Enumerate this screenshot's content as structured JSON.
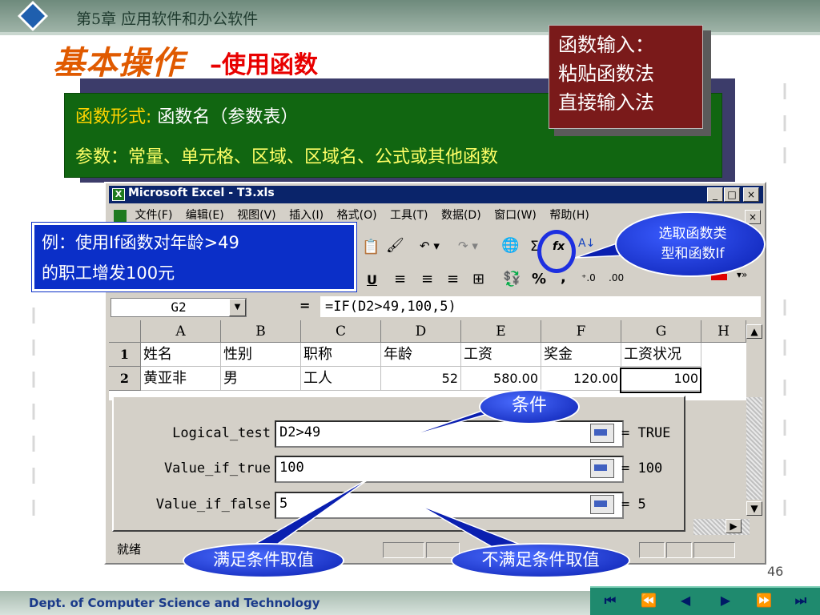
{
  "slide": {
    "chapter": "第5章 应用软件和办公软件",
    "title_main": "基本操作",
    "title_sub": "–使用函数",
    "page_number": "46",
    "footer": "Dept. of Computer Science and Technology"
  },
  "green_box": {
    "line1_label": "函数形式:",
    "line1_text": "函数名（参数表）",
    "line2": "参数：常量、单元格、区域、区域名、公式或其他函数"
  },
  "red_box": {
    "line1": "函数输入：",
    "line2": "粘贴函数法",
    "line3": "直接输入法"
  },
  "callouts": {
    "example_line1": "例：使用If函数对年龄>49",
    "example_line2": "的职工增发100元",
    "select_line1": "选取函数类",
    "select_line2": "型和函数If",
    "condition": "条件",
    "true_value": "满足条件取值",
    "false_value": "不满足条件取值"
  },
  "excel": {
    "window_title": "Microsoft Excel - T3.xls",
    "menus": [
      "文件(F)",
      "编辑(E)",
      "视图(V)",
      "插入(I)",
      "格式(O)",
      "工具(T)",
      "数据(D)",
      "窗口(W)",
      "帮助(H)"
    ],
    "name_box": "G2",
    "formula": "=IF(D2>49,100,5)",
    "columns": [
      "A",
      "B",
      "C",
      "D",
      "E",
      "F",
      "G",
      "H"
    ],
    "rows": [
      {
        "num": "1",
        "cells": [
          "姓名",
          "性别",
          "职称",
          "年龄",
          "工资",
          "奖金",
          "工资状况"
        ]
      },
      {
        "num": "2",
        "cells": [
          "黄亚非",
          "男",
          "工人",
          "52",
          "580.00",
          "120.00",
          "100"
        ]
      }
    ],
    "status": "就绪"
  },
  "dialog": {
    "args": [
      {
        "label": "Logical_test",
        "value": "D2>49",
        "result": "= TRUE"
      },
      {
        "label": "Value_if_true",
        "value": "100",
        "result": "= 100"
      },
      {
        "label": "Value_if_false",
        "value": "5",
        "result": "= 5"
      }
    ]
  },
  "nav": [
    "⏮",
    "⏪",
    "◀",
    "▶",
    "⏩",
    "⏭"
  ],
  "colors": {
    "accent_orange": "#e05a00",
    "title_red": "#e80000",
    "green_box": "#116611",
    "callout_blue": "#0b2fc8",
    "excel_title": "#0a246a"
  }
}
